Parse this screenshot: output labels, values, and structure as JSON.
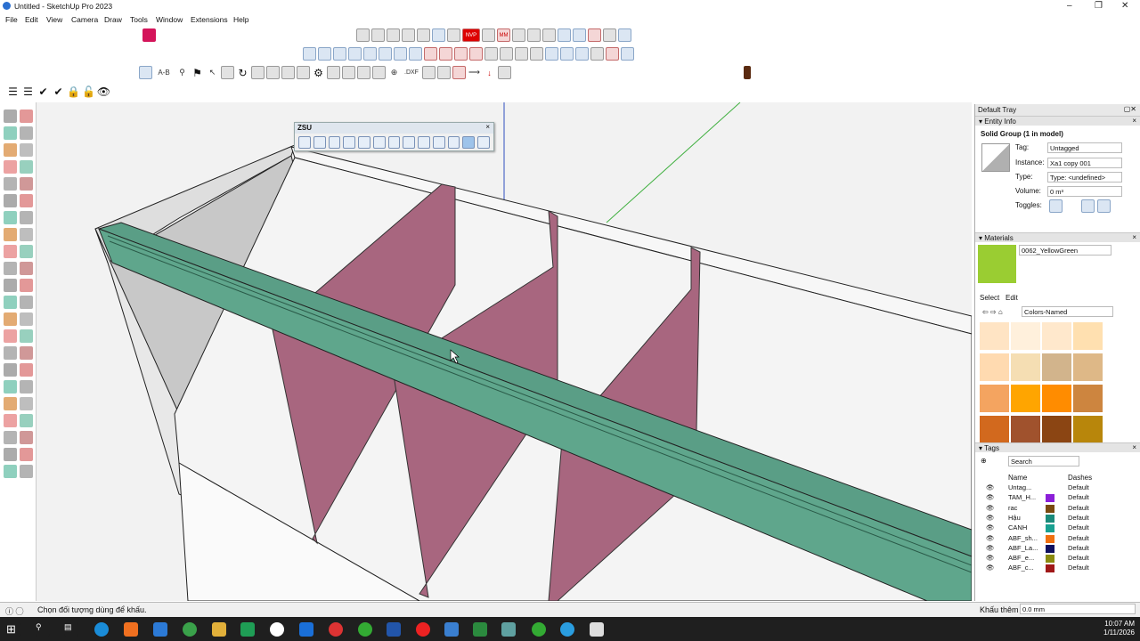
{
  "window": {
    "title": "Untitled - SketchUp Pro 2023",
    "minimize": "–",
    "restore": "❐",
    "close": "✕"
  },
  "menu": [
    "File",
    "Edit",
    "View",
    "Camera",
    "Draw",
    "Tools",
    "Window",
    "Extensions",
    "Help"
  ],
  "toolbar": {
    "ab_label": "A-B",
    "dxf_label": ".DXF",
    "mm_label": "MM",
    "nvp_label": "NVP"
  },
  "zsu": {
    "title": "ZSU",
    "close": "×"
  },
  "tray": {
    "title": "Default Tray",
    "entity_info": {
      "header": "Entity Info",
      "heading": "Solid Group (1 in model)",
      "tag_label": "Tag:",
      "tag_value": "Untagged",
      "instance_label": "Instance:",
      "instance_value": "Xa1 copy 001",
      "type_label": "Type:",
      "type_value": "Type: <undefined>",
      "volume_label": "Volume:",
      "volume_value": "0 m³",
      "toggles_label": "Toggles:"
    },
    "materials": {
      "header": "Materials",
      "name": "0062_YellowGreen",
      "tab_select": "Select",
      "tab_edit": "Edit",
      "library": "Colors-Named",
      "preview_color": "#9acd32",
      "swatches": [
        "#ffe4c4",
        "#fff0dc",
        "#ffe8cc",
        "#ffe0b0",
        "#ffdab0",
        "#f5deb3",
        "#d2b48c",
        "#deb887",
        "#f4a460",
        "#ffa500",
        "#ff8c00",
        "#cd853f",
        "#d2691e",
        "#a0522d",
        "#8b4513",
        "#b8860b"
      ]
    },
    "tags": {
      "header": "Tags",
      "search_placeholder": "Search",
      "col_name": "Name",
      "col_dashes": "Dashes",
      "rows": [
        {
          "name": "Untag...",
          "dash": "Default",
          "color": ""
        },
        {
          "name": "TAM_H...",
          "dash": "Default",
          "color": "#8b1fd8"
        },
        {
          "name": "rac",
          "dash": "Default",
          "color": "#7a4a10"
        },
        {
          "name": "Hậu",
          "dash": "Default",
          "color": "#1a8a7a"
        },
        {
          "name": "CANH",
          "dash": "Default",
          "color": "#18a090"
        },
        {
          "name": "ABF_sh...",
          "dash": "Default",
          "color": "#f07010"
        },
        {
          "name": "ABF_La...",
          "dash": "Default",
          "color": "#101060"
        },
        {
          "name": "ABF_e...",
          "dash": "Default",
          "color": "#8a8a10"
        },
        {
          "name": "ABF_c...",
          "dash": "Default",
          "color": "#a01818"
        }
      ]
    }
  },
  "status": {
    "message": "Chọn đối tượng dùng để khấu.",
    "measure_label": "Khấu thêm",
    "measure_value": "0.0 mm"
  },
  "clock": {
    "time": "10:07 AM",
    "date": "1/11/2026"
  }
}
